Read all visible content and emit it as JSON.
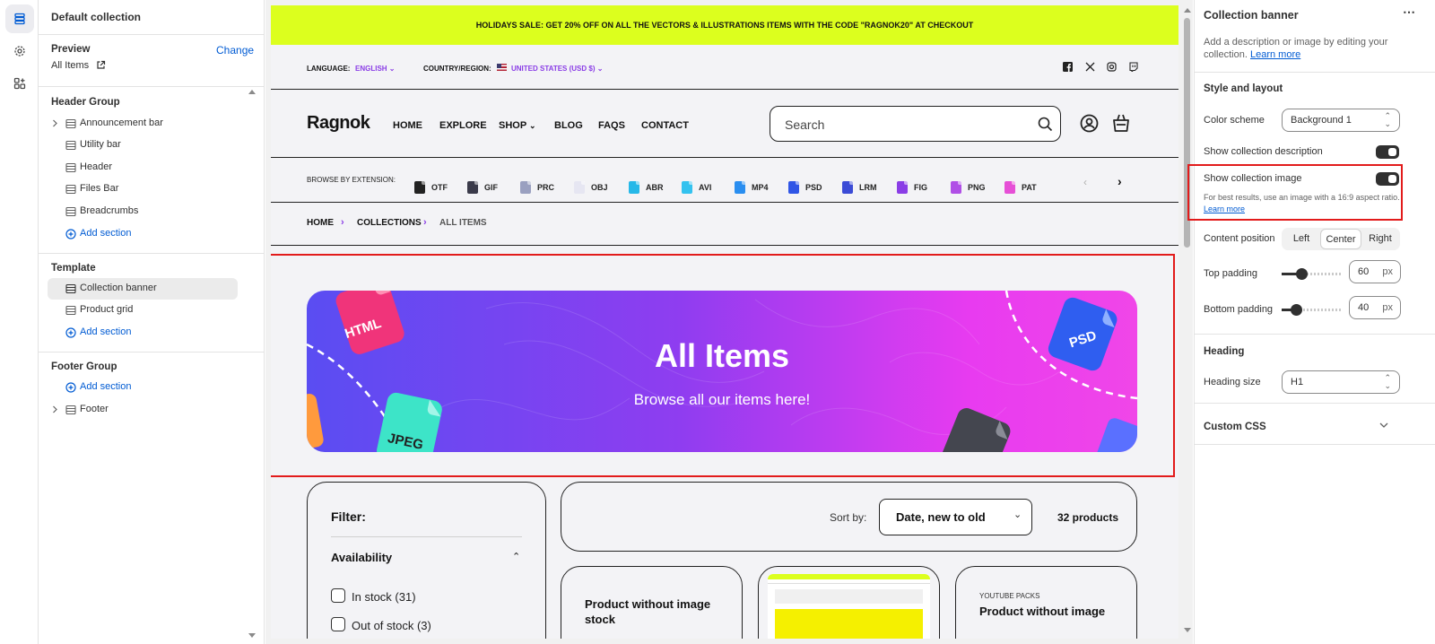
{
  "sidebar": {
    "title": "Default collection",
    "preview_label": "Preview",
    "change_label": "Change",
    "preview_value": "All Items",
    "groups": [
      {
        "title": "Header Group",
        "items": [
          "Announcement bar",
          "Utility bar",
          "Header",
          "Files Bar",
          "Breadcrumbs"
        ],
        "add": "Add section"
      },
      {
        "title": "Template",
        "items": [
          "Collection banner",
          "Product grid"
        ],
        "add": "Add section"
      },
      {
        "title": "Footer Group",
        "items": [
          "Footer"
        ],
        "add": "Add section"
      }
    ]
  },
  "store": {
    "announcement": "HOLIDAYS SALE: GET 20% OFF ON ALL THE VECTORS & ILLUSTRATIONS ITEMS WITH THE CODE \"RAGNOK20\" AT CHECKOUT",
    "language_label": "LANGUAGE:",
    "language_value": "ENGLISH",
    "country_label": "COUNTRY/REGION:",
    "country_value": "UNITED STATES (USD $)",
    "logo": "Ragnok",
    "nav": [
      "HOME",
      "EXPLORE",
      "SHOP",
      "BLOG",
      "FAQS",
      "CONTACT"
    ],
    "search_placeholder": "Search",
    "browse_label": "BROWSE BY EXTENSION:",
    "extensions": [
      {
        "label": "OTF",
        "color": "#222222"
      },
      {
        "label": "GIF",
        "color": "#3a3a4a"
      },
      {
        "label": "PRC",
        "color": "#9aa0c0"
      },
      {
        "label": "OBJ",
        "color": "#e6e6f2"
      },
      {
        "label": "ABR",
        "color": "#26b8e8"
      },
      {
        "label": "AVI",
        "color": "#33c2ef"
      },
      {
        "label": "MP4",
        "color": "#2a8ef0"
      },
      {
        "label": "PSD",
        "color": "#2f55e6"
      },
      {
        "label": "LRM",
        "color": "#3b4bd6"
      },
      {
        "label": "FIG",
        "color": "#8a3de6"
      },
      {
        "label": "PNG",
        "color": "#b04fe6"
      },
      {
        "label": "PAT",
        "color": "#e64fd6"
      }
    ],
    "breadcrumbs": [
      "HOME",
      "COLLECTIONS",
      "ALL ITEMS"
    ],
    "banner": {
      "title": "All Items",
      "subtitle": "Browse all our items here!",
      "tags": [
        "HTML",
        "PSD",
        "JPEG"
      ]
    },
    "filter_title": "Filter:",
    "availability_label": "Availability",
    "filter_options": [
      "In stock (31)",
      "Out of stock (3)"
    ],
    "sort_label": "Sort by:",
    "sort_value": "Date, new to old",
    "count": "32 products",
    "product_cards": [
      {
        "subtitle": "",
        "title": "Product without image stock"
      },
      {
        "subtitle": "",
        "title": ""
      },
      {
        "subtitle": "YOUTUBE PACKS",
        "title": "Product without image"
      }
    ]
  },
  "panel": {
    "title": "Collection banner",
    "desc": "Add a description or image by editing your collection.",
    "learn_more": "Learn more",
    "style_heading": "Style and layout",
    "color_scheme_label": "Color scheme",
    "color_scheme_value": "Background 1",
    "show_desc_label": "Show collection description",
    "show_image_label": "Show collection image",
    "image_hint": "For best results, use an image with a 16:9 aspect ratio.",
    "content_position_label": "Content position",
    "positions": [
      "Left",
      "Center",
      "Right"
    ],
    "top_padding_label": "Top padding",
    "top_padding_value": "60",
    "bottom_padding_label": "Bottom padding",
    "bottom_padding_value": "40",
    "unit": "px",
    "heading_heading": "Heading",
    "heading_size_label": "Heading size",
    "heading_size_value": "H1",
    "custom_css_label": "Custom CSS",
    "colors": {
      "accent": "#005bd3",
      "highlight": "#e21b1b",
      "announcement": "#dcff1e"
    }
  }
}
